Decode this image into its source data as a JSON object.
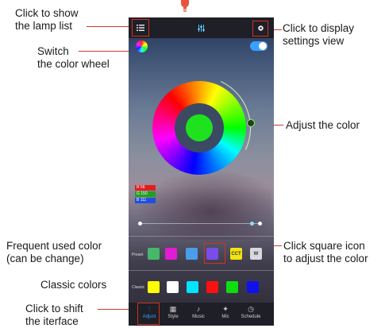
{
  "callouts": {
    "lamp_list": [
      "Click to show",
      "the lamp list"
    ],
    "settings_view": [
      "Click to display",
      "settings view"
    ],
    "color_wheel": [
      "Switch",
      "the color wheel"
    ],
    "adjust_color": "Adjust the color",
    "frequent_color": [
      "Frequent used color",
      "(can be change)"
    ],
    "square_icon": [
      "Click square icon",
      "to adjust the color"
    ],
    "classic_colors": "Classic colors",
    "shift_interface": [
      "Click to shift",
      "the iterface"
    ]
  },
  "app": {
    "rgb": [
      {
        "label": "R 56",
        "color": "#e02020"
      },
      {
        "label": "G 150",
        "color": "#20a020"
      },
      {
        "label": "B 111",
        "color": "#2050e0"
      }
    ],
    "preset_label": "Preset",
    "preset_colors": [
      {
        "color": "#45b86a",
        "text": ""
      },
      {
        "color": "#e21cd2",
        "text": ""
      },
      {
        "color": "#4a9de8",
        "text": ""
      },
      {
        "color": "#7a4de8",
        "text": ""
      },
      {
        "color": "#f4e40e",
        "text": "CCT"
      },
      {
        "color": "#d8d8de",
        "text": "W"
      }
    ],
    "classic_label": "Classic",
    "classic_colors": [
      "#ffff00",
      "#ffffff",
      "#00e5ff",
      "#ff1010",
      "#10dd10",
      "#1010ee"
    ],
    "tabs": [
      {
        "label": "Adjust",
        "icon": "sliders-icon",
        "glyph": "⫶",
        "active": true
      },
      {
        "label": "Style",
        "icon": "grid-icon",
        "glyph": "▦",
        "active": false
      },
      {
        "label": "Music",
        "icon": "music-icon",
        "glyph": "♪",
        "active": false
      },
      {
        "label": "Mic",
        "icon": "mic-icon",
        "glyph": "✦",
        "active": false
      },
      {
        "label": "Schedule",
        "icon": "clock-icon",
        "glyph": "◷",
        "active": false
      }
    ]
  }
}
